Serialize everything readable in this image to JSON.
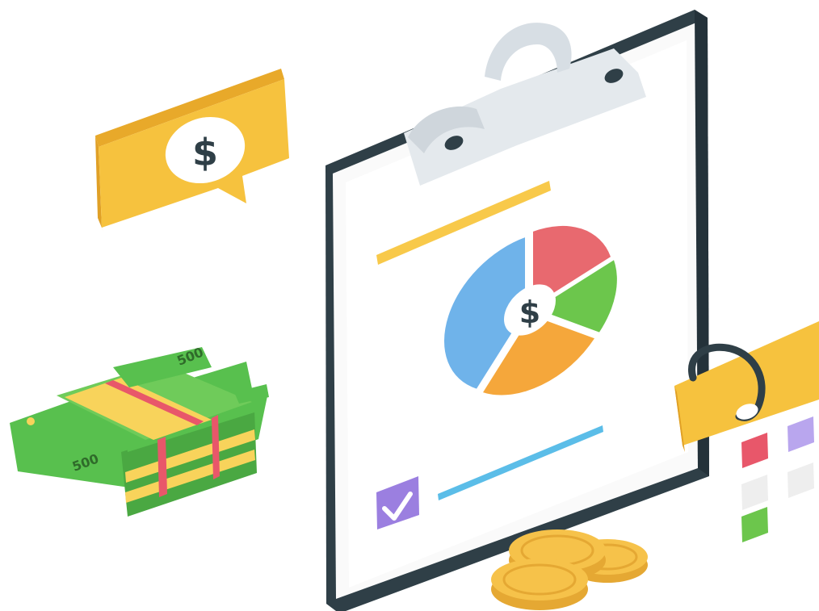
{
  "colors": {
    "background": "#ffffff",
    "board_frame": "#2f3f47",
    "clip_metal": "#d7dee4",
    "bubble_yellow": "#f6c23e",
    "bubble_shadow": "#e8a92a",
    "pie_blue": "#6fb3ea",
    "pie_red": "#e8696f",
    "pie_green": "#6cc64c",
    "pie_orange": "#f5a73b",
    "bar_yellow": "#f8c94a",
    "bar_blue": "#5bbde8",
    "checkbox_purple": "#9b7fe0",
    "cash_green": "#58c04e",
    "cash_band_yellow": "#f8d35b",
    "cash_band_red": "#e8576a",
    "coin_gold": "#f6c24a"
  },
  "speech_bubble": {
    "symbol": "$",
    "icon": "dollar-icon"
  },
  "pie_chart": {
    "center_symbol": "$",
    "slice_colors": [
      "pie_red",
      "pie_green",
      "pie_orange",
      "pie_blue"
    ]
  },
  "checkbox": {
    "checked": true,
    "icon": "checkmark-icon"
  },
  "cash_stack": {
    "top_note_label": "500",
    "bottom_note_label": "500",
    "icon": "cash-stack-icon"
  },
  "coins": {
    "icon": "bitcoin-coin-icon",
    "count": 3
  },
  "calendar": {
    "icon": "calendar-icon"
  }
}
